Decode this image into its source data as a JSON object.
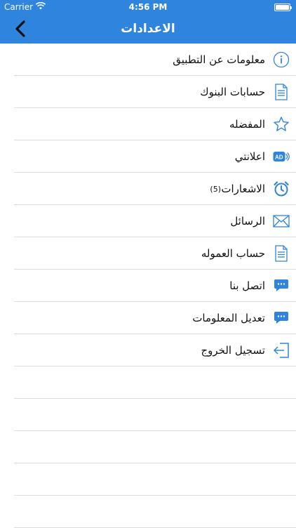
{
  "status_bar": {
    "carrier": "Carrier",
    "time": "4:56 PM",
    "wifi_icon": "wifi-icon",
    "battery_icon": "battery-icon",
    "battery_level": 1.0
  },
  "nav": {
    "title": "الاعدادات",
    "back_icon": "chevron-left-icon"
  },
  "colors": {
    "header": "#2f84dd",
    "icon": "#2f84dd",
    "divider": "#dcdcdc"
  },
  "menu": [
    {
      "label": "معلومات عن التطبيق",
      "icon": "info-icon"
    },
    {
      "label": "حسابات البنوك",
      "icon": "document-icon"
    },
    {
      "label": "المفضله",
      "icon": "star-icon"
    },
    {
      "label": "اعلانتي",
      "icon": "ad-icon"
    },
    {
      "label": "الاشعارات",
      "icon": "alarm-clock-icon",
      "count": "(5)"
    },
    {
      "label": "الرسائل",
      "icon": "envelope-icon"
    },
    {
      "label": "حساب العموله",
      "icon": "document-icon"
    },
    {
      "label": "اتصل بنا",
      "icon": "chat-bubble-icon"
    },
    {
      "label": "تعديل المعلومات",
      "icon": "chat-bubble-icon"
    },
    {
      "label": "تسجيل الخروج",
      "icon": "logout-icon"
    }
  ]
}
